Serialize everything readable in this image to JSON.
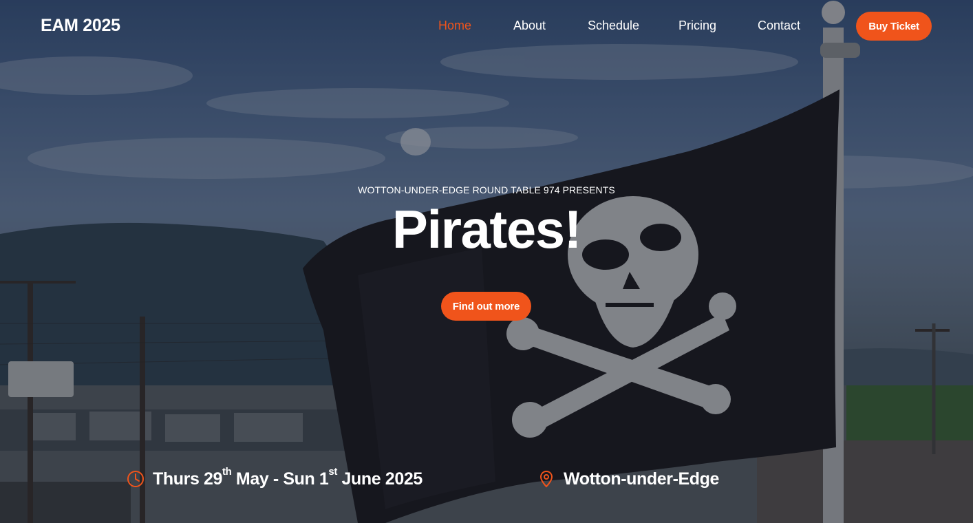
{
  "header": {
    "brand": "EAM 2025",
    "nav": [
      {
        "label": "Home",
        "active": true
      },
      {
        "label": "About",
        "active": false
      },
      {
        "label": "Schedule",
        "active": false
      },
      {
        "label": "Pricing",
        "active": false
      },
      {
        "label": "Contact",
        "active": false
      }
    ],
    "cta_label": "Buy Ticket"
  },
  "hero": {
    "eyebrow": "WOTTON-UNDER-EDGE ROUND TABLE 974 PRESENTS",
    "title": "Pirates!",
    "button_label": "Find out more",
    "background_image": "jolly-roger-pirate-flag-on-pole"
  },
  "event": {
    "date": {
      "icon": "clock-icon",
      "start_day": "Thurs 29",
      "start_suffix": "th",
      "middle": " May - Sun 1",
      "end_suffix": "st",
      "end": " June 2025"
    },
    "location": {
      "icon": "map-pin-icon",
      "text": "Wotton-under-Edge"
    }
  },
  "colors": {
    "accent": "#f0541b",
    "text": "#ffffff"
  }
}
